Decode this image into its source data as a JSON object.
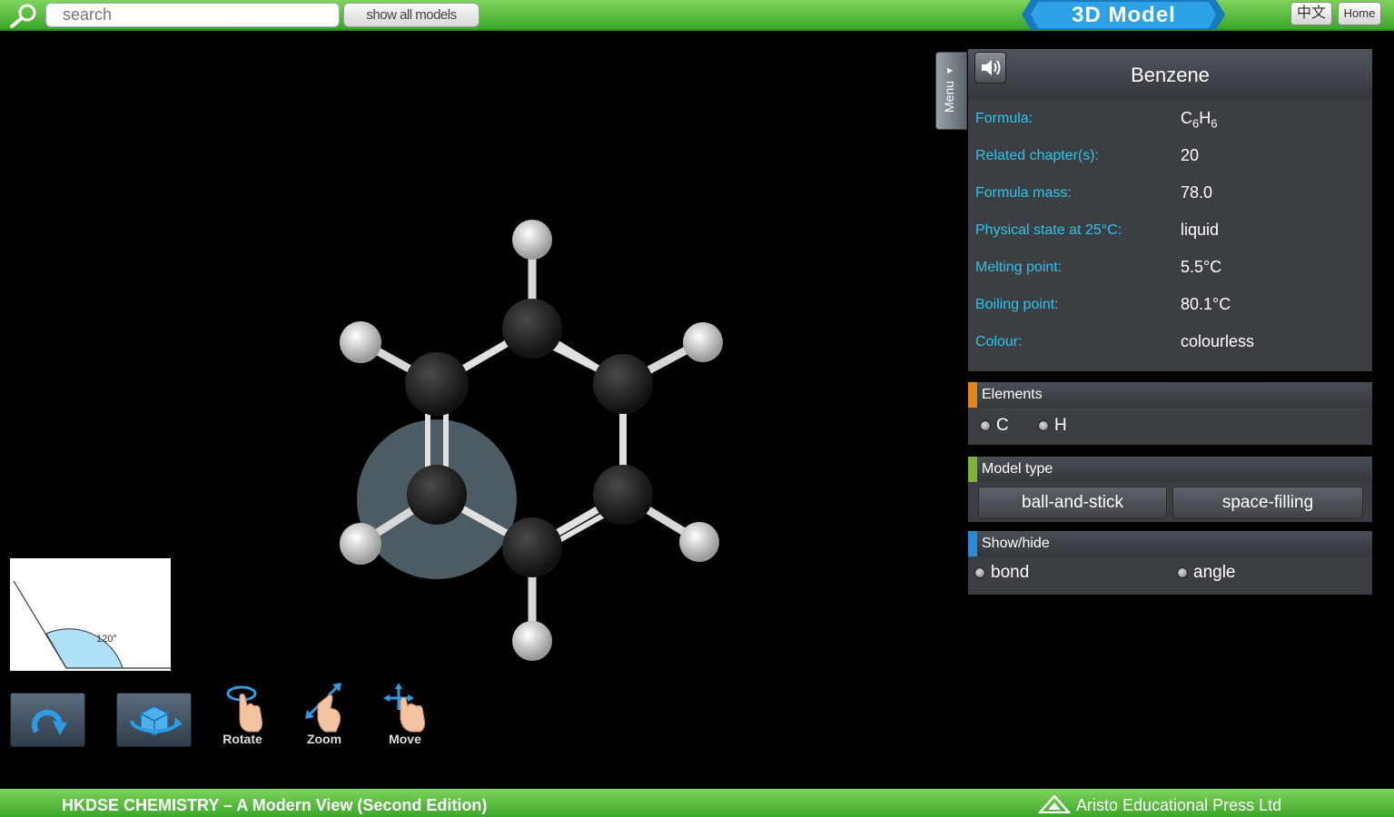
{
  "topbar": {
    "search_placeholder": "search",
    "show_all_label": "show all models",
    "title": "3D Model",
    "lang_label": "中文",
    "home_label": "Home"
  },
  "info": {
    "name": "Benzene",
    "formula_label": "Formula:",
    "formula_element_1": "C",
    "formula_sub_1": "6",
    "formula_element_2": "H",
    "formula_sub_2": "6",
    "rows": [
      {
        "label": "Related chapter(s):",
        "value": "20"
      },
      {
        "label": "Formula mass:",
        "value": "78.0"
      },
      {
        "label": "Physical state at 25°C:",
        "value": "liquid"
      },
      {
        "label": "Melting point:",
        "value": "5.5°C"
      },
      {
        "label": "Boiling point:",
        "value": "80.1°C"
      },
      {
        "label": "Colour:",
        "value": "colourless"
      }
    ]
  },
  "menu_tab_label": "Menu",
  "elements": {
    "title": "Elements",
    "items": [
      "C",
      "H"
    ],
    "accent": "#e0841c"
  },
  "model_type": {
    "title": "Model type",
    "options": [
      "ball-and-stick",
      "space-filling"
    ],
    "accent": "#7bb53a"
  },
  "show_hide": {
    "title": "Show/hide",
    "options": [
      "bond",
      "angle"
    ],
    "accent": "#2a8ad8"
  },
  "angle_thumb": {
    "label": "120°"
  },
  "gestures": {
    "rotate": "Rotate",
    "zoom": "Zoom",
    "move": "Move"
  },
  "footer": {
    "left": "HKDSE CHEMISTRY – A Modern View (Second Edition)",
    "right": "Aristo Educational Press Ltd"
  },
  "colors": {
    "bar_green": "#3aa72a",
    "label_cyan": "#2ec4e8",
    "title_blue": "#1e90d8"
  }
}
